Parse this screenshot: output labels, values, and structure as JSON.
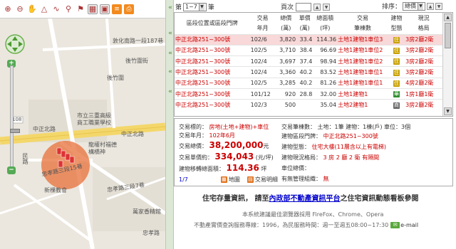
{
  "map": {
    "streets": {
      "dunhua_rd": "敦化南路一段187巷",
      "houcheng_lane": "後竹圍街",
      "housing": "後竹圍",
      "school1": "市立三重高級",
      "school2": "商工職業學校",
      "zhongzheng_n_rd": "中正北路",
      "route": "108",
      "zhongzheng_n_rd2": "中正北路",
      "chongxin": "忠孝路三段15巷",
      "chongxin2": "忠孝路三段7巷",
      "community": "龍權村福德",
      "community2": "構橋神",
      "hospital": "新棵教會",
      "pharmacy": "萬家香精館",
      "alley": "民路",
      "edge": "忠孝路"
    }
  },
  "topbar": {
    "page_prefix": "第",
    "page_range": "1~7",
    "page_suffix": "筆",
    "pager_label": "頁次",
    "sort_label": "排序：",
    "sort_value": "總價"
  },
  "table": {
    "headers": [
      [
        "區段位置或區段門牌",
        ""
      ],
      [
        "交易",
        "年月"
      ],
      [
        "總價",
        "(萬)"
      ],
      [
        "單價",
        "(萬)"
      ],
      [
        "總面積",
        "(坪)"
      ],
      [
        "交易",
        "筆棟數"
      ],
      [
        "建物",
        "型態"
      ],
      [
        "現況",
        "格局"
      ]
    ],
    "rows": [
      {
        "loc": "中正北路251~300號",
        "ym": "102/6",
        "total": "3,820",
        "unit": "33.4",
        "area": "114.36",
        "bld": "土地1建物1車位3",
        "type": "住",
        "status": "3房2廳2衛",
        "selected": true
      },
      {
        "loc": "中正北路251~300號",
        "ym": "102/5",
        "total": "3,710",
        "unit": "38.4",
        "area": "96.69",
        "bld": "土地1建物1車位2",
        "type": "住",
        "status": "3房2廳2衛",
        "selected": false
      },
      {
        "loc": "中正北路251~300號",
        "ym": "102/4",
        "total": "3,697",
        "unit": "37.4",
        "area": "98.94",
        "bld": "土地1建物1車位2",
        "type": "住",
        "status": "3房2廳2衛",
        "selected": false
      },
      {
        "loc": "中正北路251~300號",
        "ym": "102/4",
        "total": "3,360",
        "unit": "40.2",
        "area": "83.52",
        "bld": "土地1建物1車位1",
        "type": "住",
        "status": "3房2廳2衛",
        "selected": false
      },
      {
        "loc": "中正北路251~300號",
        "ym": "102/5",
        "total": "3,285",
        "unit": "40.2",
        "area": "81.26",
        "bld": "土地1建物1車位1",
        "type": "住",
        "status": "4房2廳2衛",
        "selected": false
      },
      {
        "loc": "中正北路251~300號",
        "ym": "101/12",
        "total": "920",
        "unit": "28.8",
        "area": "32.00",
        "bld": "土地1建物1",
        "type": "華",
        "status": "1房1廳1衛",
        "selected": false
      },
      {
        "loc": "中正北路251~300號",
        "ym": "102/3",
        "total": "500",
        "unit": "",
        "area": "35.04",
        "bld": "土地2建物1",
        "type": "商",
        "status": "3房2廳2衛",
        "selected": false
      }
    ]
  },
  "detail": {
    "l1_label": "交易標的：",
    "l1_value": "房地(土地+建物)+車位",
    "l2_label": "交易年月：",
    "l2_value": "102年6月",
    "l3_label": "交易總價：",
    "l3_value": "38,200,000",
    "l3_unit": "元",
    "l4_label": "交易單價約：",
    "l4_value": "334,043",
    "l4_unit": "(元/坪)",
    "l5_label": "建物移轉總面積：",
    "l5_value": "114.36",
    "l5_unit": "坪",
    "r1_label": "交易筆棟數：",
    "r1_value": "土地：1筆 建物：1棟(戶) 車位：3個",
    "r2_label": "建物區段門牌：",
    "r2_value": "中正北路251~300號",
    "r3_label": "建物型態：",
    "r3_value": "住宅大樓(11層含以上有電梯)",
    "r4_label": "建物現況格局：",
    "r4_value": "3 房 2 廳 2 衛 有隔間",
    "r5_label": "車位總價：",
    "r5_value": "",
    "r6_label": "有無管理組織：",
    "r6_value": "無",
    "counter": "1/7",
    "btn_map": "地圖",
    "btn_detail": "交易明細"
  },
  "footer": {
    "banner_prefix": "住宅存量資訊，",
    "banner_mid": "請至",
    "banner_link": "內政部不動產資訊平台",
    "banner_suffix": "之住宅資訊動態看板參閱",
    "note1": "本系統建議最佳瀏覽器採用 FireFox、Chrome、Opera",
    "note2": "不動產實價查詢服務專線：1996，為民服務時間：週一至週五08:00~17:30",
    "email": "e-mail"
  },
  "colors": {
    "accent_red": "#cc0000",
    "selected_row": "#f8d8d8",
    "link_blue": "#0000cc"
  }
}
